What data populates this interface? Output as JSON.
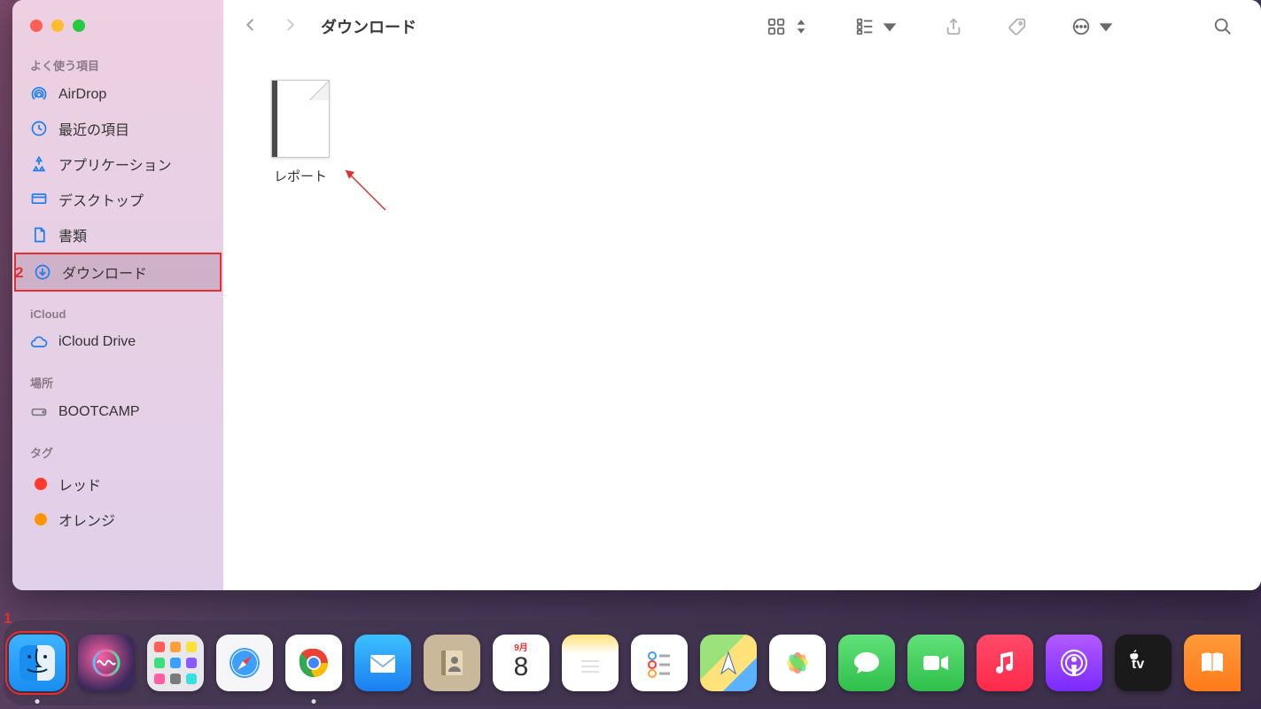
{
  "window": {
    "title": "ダウンロード"
  },
  "sidebar": {
    "sections": [
      {
        "heading": "よく使う項目",
        "items": [
          {
            "label": "AirDrop",
            "icon": "airdrop"
          },
          {
            "label": "最近の項目",
            "icon": "clock"
          },
          {
            "label": "アプリケーション",
            "icon": "app"
          },
          {
            "label": "デスクトップ",
            "icon": "desktop"
          },
          {
            "label": "書類",
            "icon": "document"
          },
          {
            "label": "ダウンロード",
            "icon": "download",
            "selected": true
          }
        ]
      },
      {
        "heading": "iCloud",
        "items": [
          {
            "label": "iCloud Drive",
            "icon": "cloud"
          }
        ]
      },
      {
        "heading": "場所",
        "items": [
          {
            "label": "BOOTCAMP",
            "icon": "disk"
          }
        ]
      },
      {
        "heading": "タグ",
        "items": [
          {
            "label": "レッド",
            "icon": "tag",
            "color": "#ff3b30"
          },
          {
            "label": "オレンジ",
            "icon": "tag",
            "color": "#ff9500"
          }
        ]
      }
    ]
  },
  "files": [
    {
      "name": "レポート"
    }
  ],
  "calendar": {
    "month": "9月",
    "day": "8"
  },
  "annotations": {
    "callout1": "1",
    "callout2": "2"
  },
  "dock": [
    {
      "name": "Finder",
      "cls": "d-finder",
      "running": true,
      "highlighted": true
    },
    {
      "name": "Siri",
      "cls": "d-siri"
    },
    {
      "name": "Launchpad",
      "cls": "d-launchpad"
    },
    {
      "name": "Safari",
      "cls": "d-safari"
    },
    {
      "name": "Chrome",
      "cls": "d-chrome",
      "running": true
    },
    {
      "name": "Mail",
      "cls": "d-mail"
    },
    {
      "name": "Contacts",
      "cls": "d-contacts"
    },
    {
      "name": "Calendar",
      "cls": "d-calendar"
    },
    {
      "name": "Notes",
      "cls": "d-notes"
    },
    {
      "name": "Reminders",
      "cls": "d-reminders"
    },
    {
      "name": "Maps",
      "cls": "d-maps"
    },
    {
      "name": "Photos",
      "cls": "d-photos"
    },
    {
      "name": "Messages",
      "cls": "d-messages"
    },
    {
      "name": "FaceTime",
      "cls": "d-facetime"
    },
    {
      "name": "Music",
      "cls": "d-music"
    },
    {
      "name": "Podcasts",
      "cls": "d-podcasts"
    },
    {
      "name": "AppleTV",
      "cls": "d-tv"
    },
    {
      "name": "Books",
      "cls": "d-books"
    }
  ]
}
